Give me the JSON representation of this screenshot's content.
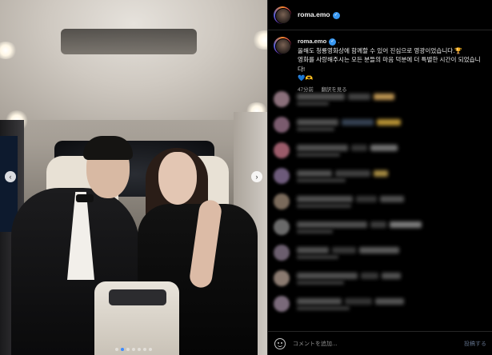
{
  "post": {
    "username": "roma.emo",
    "verified_icon": "✓",
    "caption_line1": "올해도 청룡영화상에 함께할 수 있어 진심으로 영광이었습니다.🏆",
    "caption_line2": "영화를 사랑해주시는 모든 분들의 마음 덕분에 더 특별한 시간이 되었습니다!",
    "caption_emoji": "💙🫶",
    "caption_sep": ".",
    "time_ago": "47分前",
    "translate_label": "翻訳を見る"
  },
  "carousel": {
    "prev_icon": "‹",
    "next_icon": "›",
    "slide_count": 7,
    "active_index": 1
  },
  "comment_box": {
    "placeholder": "コメントを追加...",
    "post_label": "投稿する"
  },
  "colors": {
    "accent": "#3d8bff",
    "verified": "#3897f0"
  }
}
